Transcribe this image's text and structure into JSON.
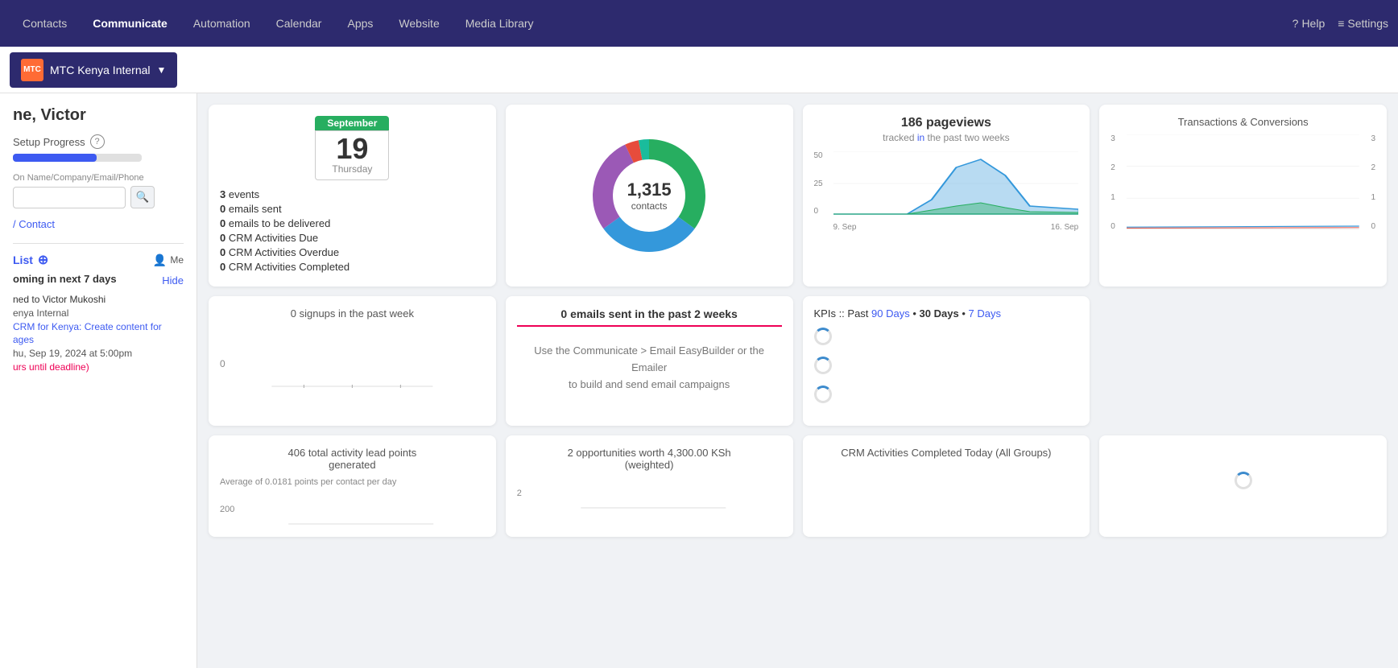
{
  "nav": {
    "items": [
      {
        "label": "Contacts",
        "active": false
      },
      {
        "label": "Communicate",
        "active": true
      },
      {
        "label": "Automation",
        "active": false
      },
      {
        "label": "Calendar",
        "active": false
      },
      {
        "label": "Apps",
        "active": false
      },
      {
        "label": "Website",
        "active": false
      },
      {
        "label": "Media Library",
        "active": false
      }
    ],
    "right": [
      {
        "label": "Help",
        "icon": "?"
      },
      {
        "label": "Settings",
        "icon": "≡"
      }
    ]
  },
  "org": {
    "name": "MTC Kenya Internal",
    "icon_text": "MTC"
  },
  "sidebar": {
    "user_name": "ne, Victor",
    "setup_progress_label": "Setup Progress",
    "progress_percent": 65,
    "search_placeholder": "On Name/Company/Email/Phone",
    "contact_link": "/ Contact",
    "list_title": "List",
    "me_label": "Me",
    "coming_up_label": "oming in next 7 days",
    "hide_label": "Hide",
    "task_assigned": "ned to Victor Mukoshi",
    "task_company": "enya Internal",
    "task_desc": "CRM for Kenya: Create content for",
    "task_desc2": "ages",
    "task_time": "hu, Sep 19, 2024 at 5:00pm",
    "task_deadline": "urs until deadline)"
  },
  "calendar_card": {
    "month": "September",
    "day": "19",
    "weekday": "Thursday",
    "stats": [
      {
        "value": "3",
        "label": "events"
      },
      {
        "value": "0",
        "label": "emails sent"
      },
      {
        "value": "0",
        "label": "emails to be delivered"
      },
      {
        "value": "0",
        "label": "CRM Activities Due"
      },
      {
        "value": "0",
        "label": "CRM Activities Overdue"
      },
      {
        "value": "0",
        "label": "CRM Activities Completed"
      }
    ]
  },
  "donut_card": {
    "center_number": "1,315",
    "center_label": "contacts",
    "segments": [
      {
        "color": "#27ae60",
        "value": 35,
        "label": "Green"
      },
      {
        "color": "#3498db",
        "value": 30,
        "label": "Blue"
      },
      {
        "color": "#9b59b6",
        "value": 28,
        "label": "Purple"
      },
      {
        "color": "#e74c3c",
        "value": 4,
        "label": "Red"
      },
      {
        "color": "#1abc9c",
        "value": 3,
        "label": "Teal"
      }
    ]
  },
  "pageviews_card": {
    "title": "186 pageviews",
    "subtitle_tracked": "tracked",
    "subtitle_in": "in",
    "subtitle_rest": "the past two weeks",
    "y_labels": [
      "50",
      "25",
      "0"
    ],
    "x_labels": [
      "9. Sep",
      "16. Sep"
    ]
  },
  "transactions_card": {
    "title": "Transactions & Conversions",
    "y_labels_left": [
      "3",
      "2",
      "1",
      "0"
    ],
    "y_labels_right": [
      "3",
      "2",
      "1",
      "0"
    ]
  },
  "signups_card": {
    "title": "0 signups in the past week",
    "zero_label": "0"
  },
  "emails_card": {
    "title": "0 emails sent in the past 2 weeks",
    "line1": "Use the Communicate > Email EasyBuilder or the",
    "line2": "Emailer",
    "line3": "to build and send email campaigns"
  },
  "kpis_card": {
    "title": "KPIs :: Past",
    "link_90": "90 Days",
    "dot1": "•",
    "link_30": "30 Days",
    "dot2": "•",
    "link_7": "7 Days",
    "loading_items": 3
  },
  "activity_card": {
    "title": "406 total activity lead points",
    "subtitle": "generated",
    "avg_label": "Average of 0.0181 points per contact per day",
    "y_label": "200"
  },
  "opportunities_card": {
    "title": "2 opportunities worth 4,300.00 KSh",
    "subtitle": "(weighted)",
    "y_label": "2"
  },
  "crm_activities_card": {
    "title": "CRM Activities Completed Today (All Groups)"
  },
  "last_card": {
    "loading": true
  }
}
